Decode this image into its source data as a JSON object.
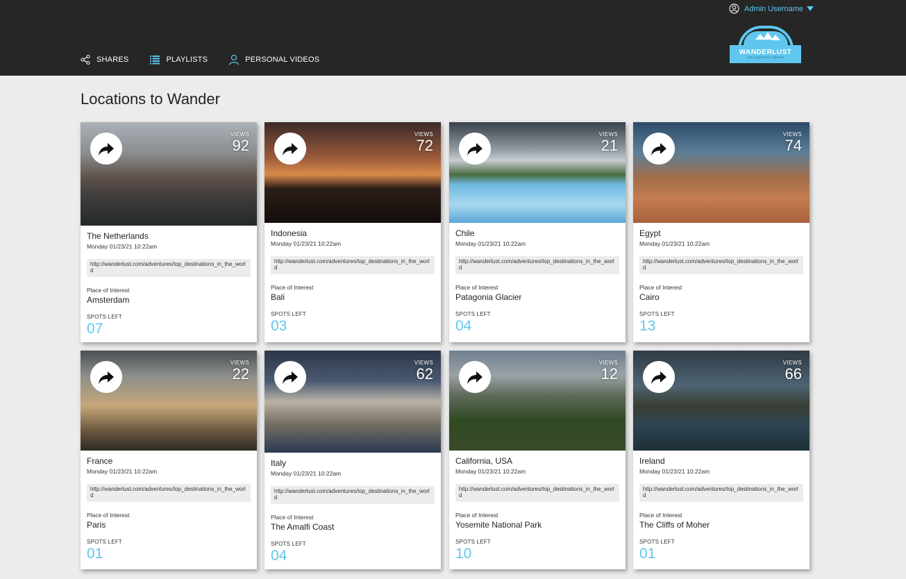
{
  "header": {
    "nav": [
      {
        "label": "SHARES",
        "icon": "share-nodes-icon"
      },
      {
        "label": "PLAYLISTS",
        "icon": "list-icon"
      },
      {
        "label": "PERSONAL VIDEOS",
        "icon": "person-icon"
      }
    ],
    "user": {
      "name": "Admin Username",
      "icon": "user-circle-icon"
    },
    "logo": {
      "brand": "WANDERLUST",
      "tagline": "THE ADVENTURE COMPANY"
    }
  },
  "page": {
    "title": "Locations to Wander"
  },
  "labels": {
    "views": "VIEWS",
    "place_of_interest": "Place of Interest",
    "spots_left": "SPOTS LEFT"
  },
  "colors": {
    "accent": "#5fc7ef",
    "header_bg": "#262626",
    "page_bg": "#ececec"
  },
  "cards": [
    {
      "location": "The Netherlands",
      "date": "Monday 01/23/21 10:22am",
      "url": "http://wanderlust.com/adventures/top_destinations_in_the_world",
      "place": "Amsterdam",
      "spots": "07",
      "views": "92"
    },
    {
      "location": "Indonesia",
      "date": "Monday 01/23/21 10:22am",
      "url": "http://wanderlust.com/adventures/top_destinations_in_the_world",
      "place": "Bali",
      "spots": "03",
      "views": "72"
    },
    {
      "location": "Chile",
      "date": "Monday 01/23/21 10:22am",
      "url": "http://wanderlust.com/adventures/top_destinations_in_the_world",
      "place": "Patagonia Glacier",
      "spots": "04",
      "views": "21"
    },
    {
      "location": "Egypt",
      "date": "Monday 01/23/21 10:22am",
      "url": "http://wanderlust.com/adventures/top_destinations_in_the_world",
      "place": "Cairo",
      "spots": "13",
      "views": "74"
    },
    {
      "location": "France",
      "date": "Monday 01/23/21 10:22am",
      "url": "http://wanderlust.com/adventures/top_destinations_in_the_world",
      "place": "Paris",
      "spots": "01",
      "views": "22"
    },
    {
      "location": "Italy",
      "date": "Monday 01/23/21 10:22am",
      "url": "http://wanderlust.com/adventures/top_destinations_in_the_world",
      "place": "The Amalfi Coast",
      "spots": "04",
      "views": "62"
    },
    {
      "location": "California, USA",
      "date": "Monday 01/23/21 10:22am",
      "url": "http://wanderlust.com/adventures/top_destinations_in_the_world",
      "place": "Yosemite National Park",
      "spots": "10",
      "views": "12"
    },
    {
      "location": "Ireland",
      "date": "Monday 01/23/21 10:22am",
      "url": "http://wanderlust.com/adventures/top_destinations_in_the_world",
      "place": "The Cliffs of Moher",
      "spots": "01",
      "views": "66"
    }
  ]
}
